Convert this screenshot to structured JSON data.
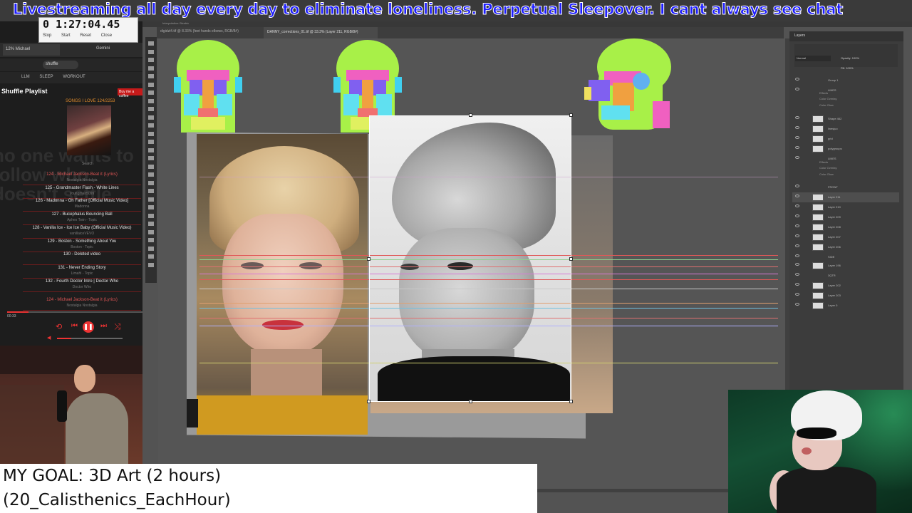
{
  "banner": {
    "text": "Livestreaming all day every day to eliminate loneliness. Perpetual Sleepover. I cant always see chat"
  },
  "timer": {
    "value": "0 1:27:04.45",
    "buttons": [
      "Stop",
      "Start",
      "Reset",
      "Close"
    ]
  },
  "browser": {
    "tab_label": "12% Michael",
    "gemini_tab": "Gemini",
    "url": "shuffle",
    "bookmarks": [
      "LLM",
      "SLEEP",
      "WORKOUT"
    ]
  },
  "playlist": {
    "title": "Shuffle Playlist",
    "buy_label": "Buy me a coffee",
    "album_title": "SONGS I LOVE 124/2253",
    "search_label": "Search",
    "ghost_text": "no one wants to follow who doesn't settle",
    "tracks": [
      {
        "title": "124 - Michael Jackson-Beat it (Lyrics)",
        "artist": "Nostalgia Nostalgia",
        "current": true
      },
      {
        "title": "125 - Grandmaster Flash - White Lines",
        "artist": "youngman5099",
        "current": false
      },
      {
        "title": "126 - Madonna - Oh Father [Official Music Video]",
        "artist": "Madonna",
        "current": false
      },
      {
        "title": "127 - Bucephalus Bouncing Ball",
        "artist": "Aphex Twin - Topic",
        "current": false
      },
      {
        "title": "128 - Vanilla Ice - Ice Ice Baby (Official Music Video)",
        "artist": "vanillaiceVEVO",
        "current": false
      },
      {
        "title": "129 - Boston - Something About You",
        "artist": "Boston - Topic",
        "current": false
      },
      {
        "title": "130 - Deleted video",
        "artist": "",
        "current": false
      },
      {
        "title": "131 - Never Ending Story",
        "artist": "Limahl - Topic",
        "current": false
      },
      {
        "title": "132 - Fourth Doctor Intro | Doctor Who",
        "artist": "Doctor Who",
        "current": false
      },
      {
        "title": "124 - Michael Jackson-Beat it (Lyrics)",
        "artist": "Nostalgia Nostalgia",
        "current": true
      }
    ],
    "elapsed": "00:33",
    "progress_fraction": 0.16,
    "volume_fraction": 0.22
  },
  "photoshop": {
    "tab1": "digidzl4.tif @ 8.33% (feet hands elbows, RGB/8#)",
    "tab2": "DANNY_corrections_01.tif @ 33.3% (Layer 211, RGB/8#)",
    "options_text": "Interpolation: Bicubic",
    "layers_title": "Layers",
    "blend_mode": "Normal",
    "opacity_label": "Opacity: 100%",
    "fill_label": "Fill: 100%",
    "layers": [
      {
        "name": "Group 1",
        "thumb": false,
        "selected": false
      },
      {
        "name": "LINES",
        "thumb": false,
        "selected": false
      },
      {
        "name": "Shape 462",
        "thumb": true,
        "selected": false
      },
      {
        "name": "linesjuo",
        "thumb": true,
        "selected": false
      },
      {
        "name": "grid",
        "thumb": true,
        "selected": false
      },
      {
        "name": "polygroups",
        "thumb": true,
        "selected": false
      },
      {
        "name": "LINES",
        "thumb": false,
        "selected": false
      },
      {
        "name": "FRONT",
        "thumb": false,
        "selected": false
      },
      {
        "name": "Layer 211",
        "thumb": true,
        "selected": true
      },
      {
        "name": "Layer 210",
        "thumb": true,
        "selected": false
      },
      {
        "name": "Layer 209",
        "thumb": true,
        "selected": false
      },
      {
        "name": "Layer 208",
        "thumb": true,
        "selected": false
      },
      {
        "name": "Layer 207",
        "thumb": true,
        "selected": false
      },
      {
        "name": "Layer 206",
        "thumb": true,
        "selected": false
      },
      {
        "name": "SIDE",
        "thumb": false,
        "selected": false
      },
      {
        "name": "Layer 196",
        "thumb": true,
        "selected": false
      },
      {
        "name": "3QTR",
        "thumb": false,
        "selected": false
      },
      {
        "name": "Layer 202",
        "thumb": true,
        "selected": false
      },
      {
        "name": "Layer 203",
        "thumb": true,
        "selected": false
      },
      {
        "name": "Layer 0",
        "thumb": true,
        "selected": false
      }
    ],
    "effects": [
      "Effects",
      "Color Overlay",
      "Color Glow"
    ]
  },
  "goal": {
    "line1": "MY GOAL: 3D Art (2 hours)",
    "line2": "(20_Calisthenics_EachHour)"
  },
  "colors": {
    "banner_text": "#1c1cff",
    "accent_red": "#e33333",
    "ps_bg": "#535353"
  }
}
